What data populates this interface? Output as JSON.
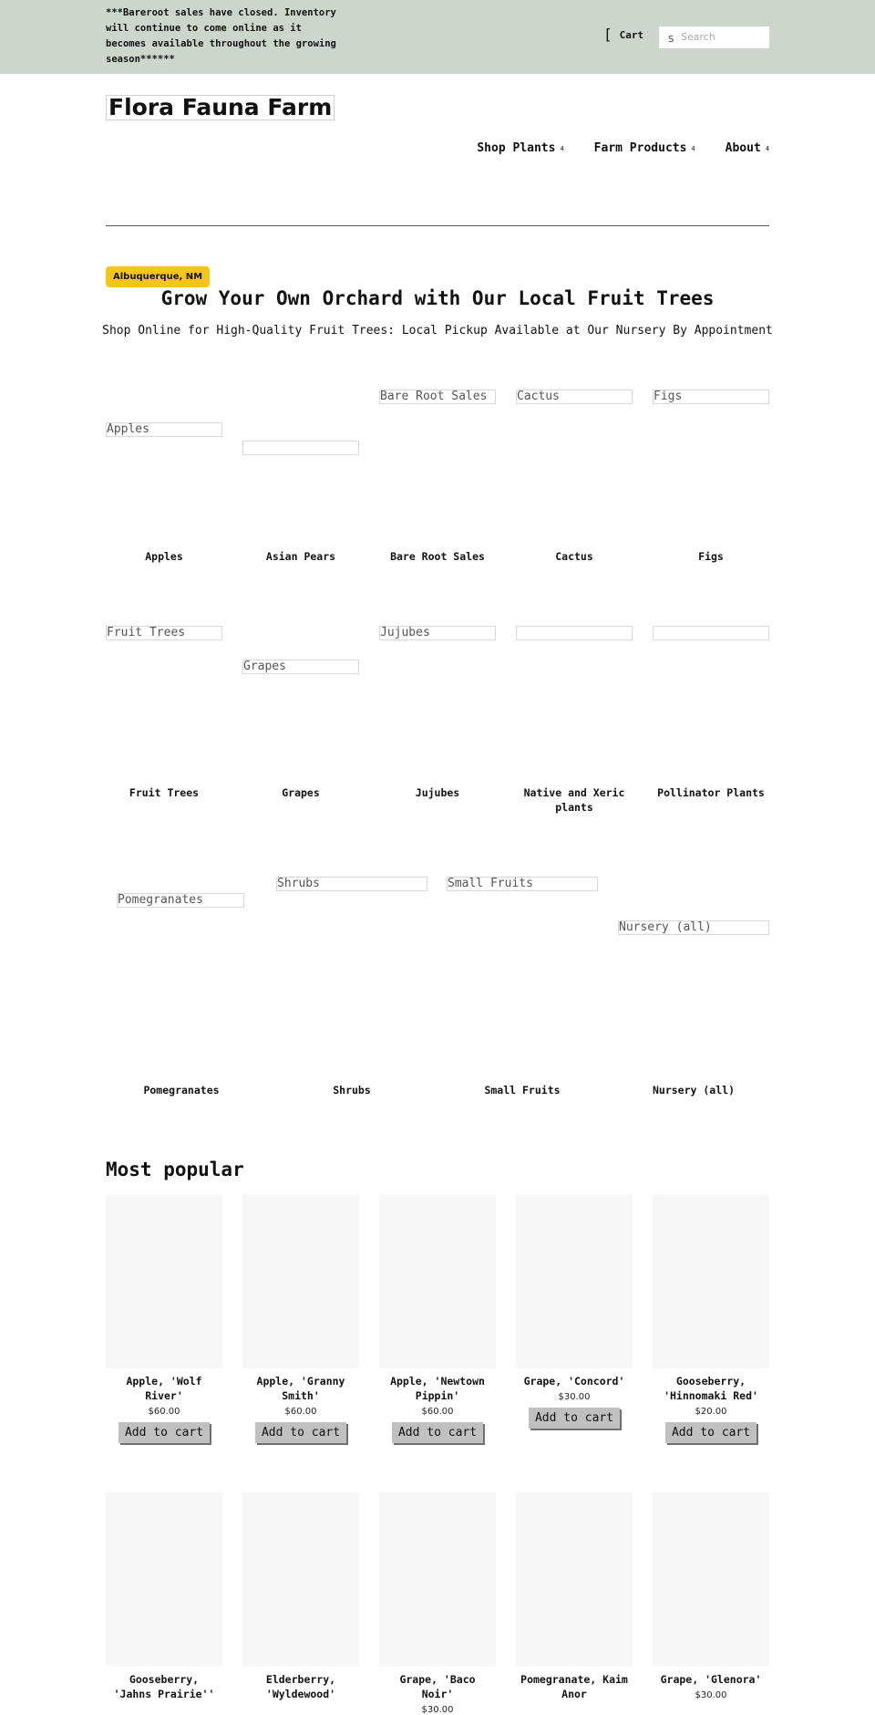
{
  "announcement": "***Bareroot sales have closed. Inventory will continue to come online as it becomes available throughout the growing season******",
  "header": {
    "cart_icon": "[",
    "cart_label": "Cart",
    "search_icon": "S",
    "search_placeholder": "Search",
    "search_value": ""
  },
  "site_title": "Flora Fauna Farm",
  "nav": [
    {
      "label": "Shop Plants",
      "caret": "4"
    },
    {
      "label": "Farm Products",
      "caret": "4"
    },
    {
      "label": "About",
      "caret": "4"
    }
  ],
  "hero": {
    "badge": "Albuquerque, NM",
    "badge_color": "#f5c518",
    "title": "Grow Your Own Orchard with Our Local Fruit Trees",
    "subtitle": "Shop Online for High-Quality Fruit Trees: Local Pickup Available at Our Nursery By Appointment"
  },
  "categories": [
    {
      "alt": "Apples",
      "label": "Apples"
    },
    {
      "alt": "",
      "label": "Asian Pears"
    },
    {
      "alt": "Bare Root Sales",
      "label": "Bare Root Sales"
    },
    {
      "alt": "Cactus",
      "label": "Cactus"
    },
    {
      "alt": "Figs",
      "label": "Figs"
    },
    {
      "alt": "Fruit Trees",
      "label": "Fruit Trees"
    },
    {
      "alt": "Grapes",
      "label": "Grapes"
    },
    {
      "alt": "Jujubes",
      "label": "Jujubes"
    },
    {
      "alt": "",
      "label": "Native and Xeric plants"
    },
    {
      "alt": "",
      "label": "Pollinator Plants"
    },
    {
      "alt": "Pomegranates",
      "label": "Pomegranates"
    },
    {
      "alt": "Shrubs",
      "label": "Shrubs"
    },
    {
      "alt": "Small Fruits",
      "label": "Small Fruits"
    },
    {
      "alt": "Nursery (all)",
      "label": "Nursery (all)"
    }
  ],
  "most_popular": {
    "title": "Most popular",
    "add_to_cart_label": "Add to cart",
    "products": [
      {
        "name": "Apple, 'Wolf River'",
        "price": "$60.00"
      },
      {
        "name": "Apple, 'Granny Smith'",
        "price": "$60.00"
      },
      {
        "name": "Apple, 'Newtown Pippin'",
        "price": "$60.00"
      },
      {
        "name": "Grape, 'Concord'",
        "price": "$30.00"
      },
      {
        "name": "Gooseberry, 'Hinnomaki Red'",
        "price": "$20.00"
      },
      {
        "name": "Gooseberry, 'Jahns Prairie''",
        "price": ""
      },
      {
        "name": "Elderberry, 'Wyldewood'",
        "price": ""
      },
      {
        "name": "Grape, 'Baco Noir'",
        "price": "$30.00"
      },
      {
        "name": "Pomegranate, Kaim Anor",
        "price": ""
      },
      {
        "name": "Grape, 'Glenora'",
        "price": "$30.00"
      }
    ]
  }
}
